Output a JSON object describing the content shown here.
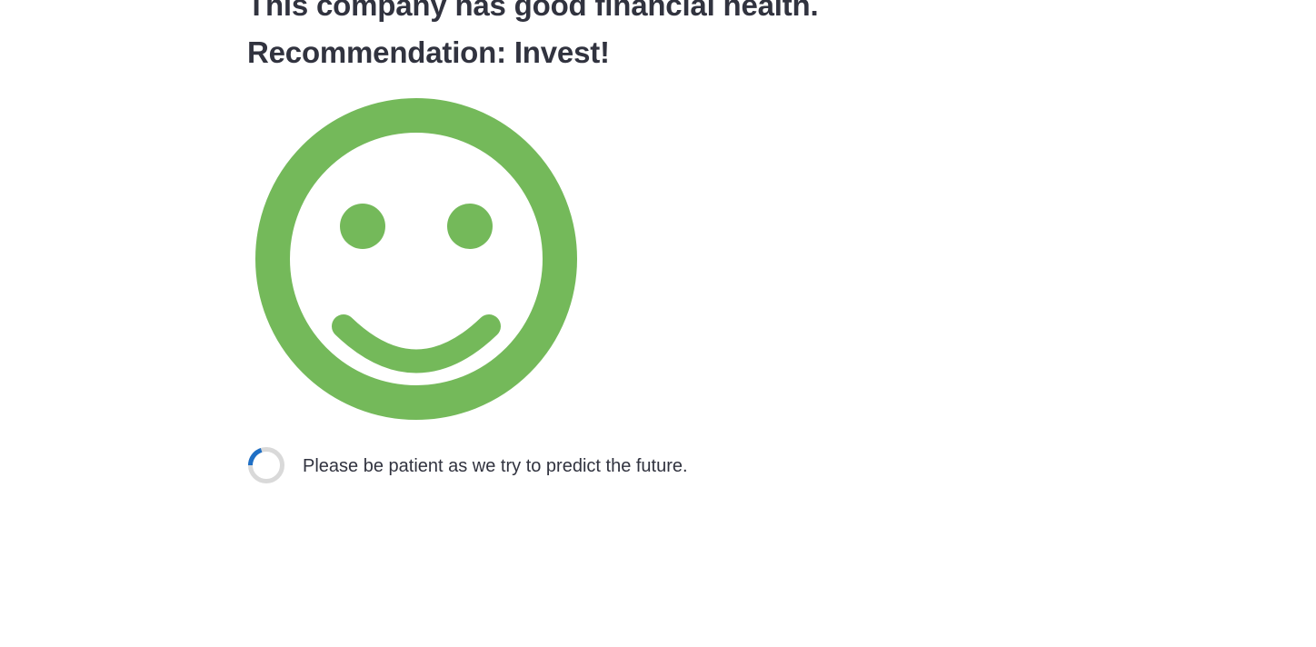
{
  "result": {
    "headline": "This company has good financial health. Recommendation: Invest!",
    "indicator_icon": "smiley-face-icon",
    "indicator_color": "#74b95a"
  },
  "loading": {
    "spinner_icon": "loading-spinner-icon",
    "spinner_color": "#1f6fc5",
    "spinner_track_color": "#d9d9d9",
    "message": "Please be patient as we try to predict the future."
  }
}
